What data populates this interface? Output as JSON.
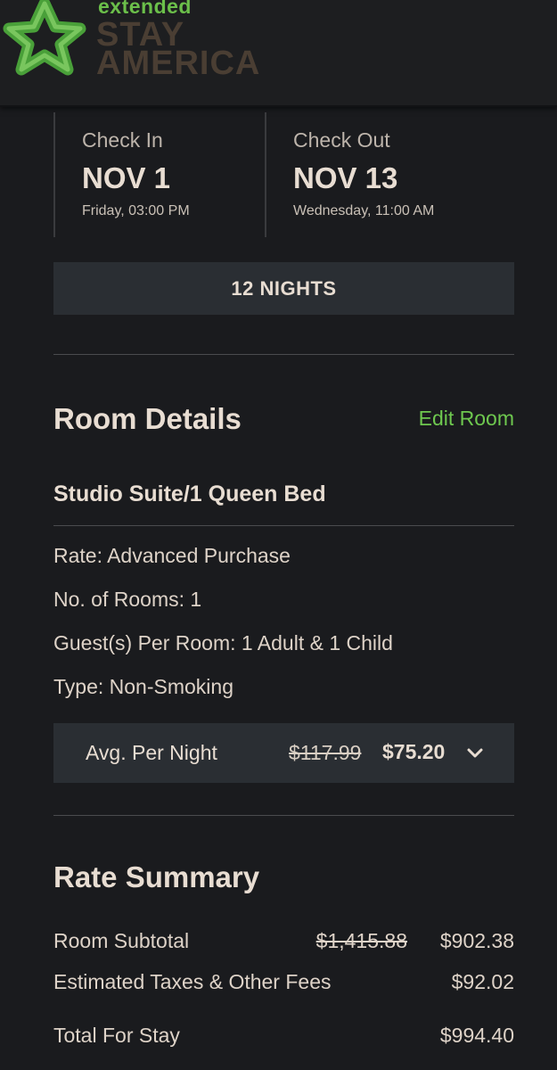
{
  "brand": {
    "line1": "extended",
    "line2": "STAY",
    "line3": "AMERICA",
    "green": "#6bbf4a",
    "brown": "#4a3e33",
    "logo_icon": "star-logo-icon"
  },
  "stay": {
    "check_in": {
      "label": "Check In",
      "date": "NOV 1",
      "detail": "Friday, 03:00 PM"
    },
    "check_out": {
      "label": "Check Out",
      "date": "NOV 13",
      "detail": "Wednesday, 11:00 AM"
    },
    "nights": "12 NIGHTS"
  },
  "room_details": {
    "title": "Room Details",
    "edit_label": "Edit Room",
    "room_name": "Studio Suite/1 Queen Bed",
    "rate": "Rate: Advanced Purchase",
    "rooms": "No. of Rooms: 1",
    "guests": "Guest(s) Per Room: 1 Adult & 1 Child",
    "type": "Type: Non-Smoking",
    "avg": {
      "label": "Avg. Per Night",
      "original": "$117.99",
      "price": "$75.20",
      "icon": "chevron-down-icon"
    }
  },
  "rate_summary": {
    "title": "Rate Summary",
    "subtotal": {
      "label": "Room Subtotal",
      "original": "$1,415.88",
      "value": "$902.38"
    },
    "taxes": {
      "label": "Estimated Taxes & Other Fees",
      "value": "$92.02"
    },
    "total": {
      "label": "Total For Stay",
      "value": "$994.40"
    }
  },
  "colors": {
    "background": "#1a1b1e",
    "panel": "#2a2e33",
    "accent_green": "#6ec84f",
    "text": "#e8ddd2"
  }
}
